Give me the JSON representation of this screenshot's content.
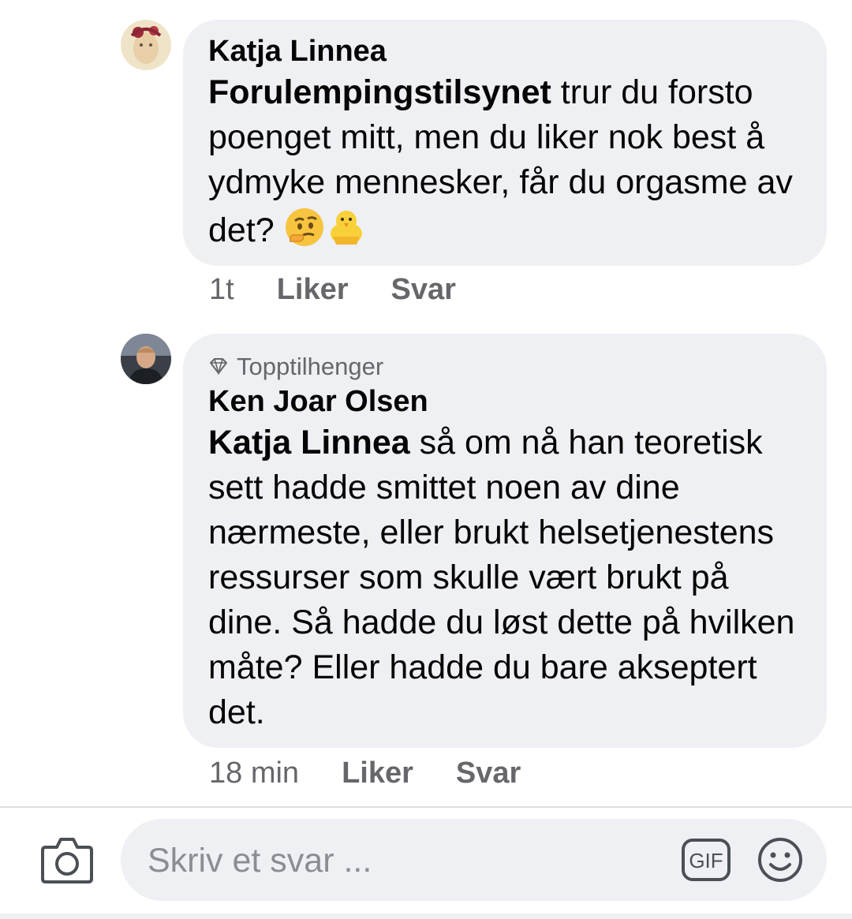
{
  "comments": [
    {
      "author": "Katja Linnea",
      "badge": "",
      "mention": "Forulempingstilsynet",
      "text": " trur du forsto poenget mitt, men du liker nok best å ydmyke mennesker, får du orgasme av det? ",
      "emoji": [
        "thinking-face-emoji",
        "hatching-chick-emoji"
      ],
      "time": "1t",
      "like_label": "Liker",
      "reply_label": "Svar"
    },
    {
      "author": "Ken Joar Olsen",
      "badge": "Topptilhenger",
      "mention": "Katja Linnea",
      "text": " så om nå han teoretisk sett hadde smittet noen av dine nærmeste, eller brukt helsetjenestens ressurser som skulle vært brukt på dine. Så hadde du løst dette på hvilken måte? Eller hadde du bare akseptert det.",
      "time": "18 min",
      "like_label": "Liker",
      "reply_label": "Svar"
    }
  ],
  "composer": {
    "placeholder": "Skriv et svar ...",
    "gif_label": "GIF"
  },
  "icons": {
    "camera": "camera-icon",
    "gif": "gif-icon",
    "emoji": "smiley-icon",
    "badge": "diamond-icon"
  },
  "colors": {
    "bubble": "#eff0f4",
    "meta_text": "#65676b",
    "text": "#050505"
  }
}
